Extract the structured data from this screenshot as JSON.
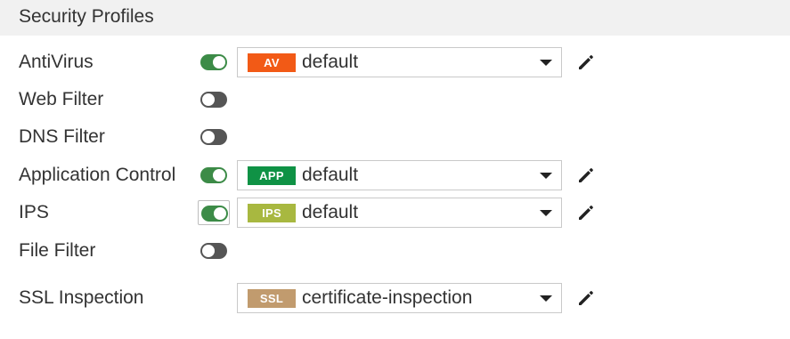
{
  "section": {
    "title": "Security Profiles"
  },
  "colors": {
    "toggle_on": "#3c8b47",
    "toggle_off": "#555555",
    "header_bg": "#f1f1f1"
  },
  "rows": [
    {
      "id": "antivirus",
      "label": "AntiVirus",
      "enabled": true,
      "profile": {
        "badge": "AV",
        "badge_color": "#f25a16",
        "value": "default"
      },
      "icons": {
        "toggle": "toggle-switch",
        "dropdown": "chevron-down-icon",
        "edit": "pencil-icon"
      }
    },
    {
      "id": "web-filter",
      "label": "Web Filter",
      "enabled": false
    },
    {
      "id": "dns-filter",
      "label": "DNS Filter",
      "enabled": false
    },
    {
      "id": "application-control",
      "label": "Application Control",
      "enabled": true,
      "profile": {
        "badge": "APP",
        "badge_color": "#0f9245",
        "value": "default"
      },
      "icons": {
        "toggle": "toggle-switch",
        "dropdown": "chevron-down-icon",
        "edit": "pencil-icon"
      }
    },
    {
      "id": "ips",
      "label": "IPS",
      "enabled": true,
      "focused": true,
      "profile": {
        "badge": "IPS",
        "badge_color": "#a8b840",
        "value": "default"
      },
      "icons": {
        "toggle": "toggle-switch",
        "dropdown": "chevron-down-icon",
        "edit": "pencil-icon"
      }
    },
    {
      "id": "file-filter",
      "label": "File Filter",
      "enabled": false
    },
    {
      "id": "ssl-inspection",
      "label": "SSL Inspection",
      "profile": {
        "badge": "SSL",
        "badge_color": "#c19b6e",
        "value": "certificate-inspection"
      },
      "icons": {
        "dropdown": "chevron-down-icon",
        "edit": "pencil-icon"
      }
    }
  ]
}
